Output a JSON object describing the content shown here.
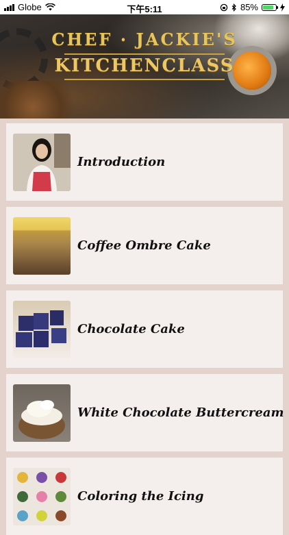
{
  "status_bar": {
    "carrier": "Globe",
    "time": "下午5:11",
    "battery_percent": "85%",
    "battery_level": 0.85,
    "icons": [
      "signal-icon",
      "wifi-icon",
      "orientation-lock-icon",
      "bluetooth-icon",
      "battery-icon",
      "charging-icon"
    ]
  },
  "banner": {
    "title_line1": "CHEF · JACKIE'S",
    "title_line2": "KITCHENCLASS"
  },
  "lessons": [
    {
      "label": "Introduction",
      "thumb": "chef-portrait"
    },
    {
      "label": "Coffee Ombre Cake",
      "thumb": "ombre-cake"
    },
    {
      "label": "Chocolate Cake",
      "thumb": "chocolate-cake-cubes"
    },
    {
      "label": "White Chocolate Buttercream",
      "thumb": "buttercream-bowl"
    },
    {
      "label": "Coloring the Icing",
      "thumb": "colored-icing-dots"
    }
  ],
  "colors": {
    "background": "#e3d3cc",
    "card": "#f4efed",
    "gold": "#e8c55a"
  }
}
